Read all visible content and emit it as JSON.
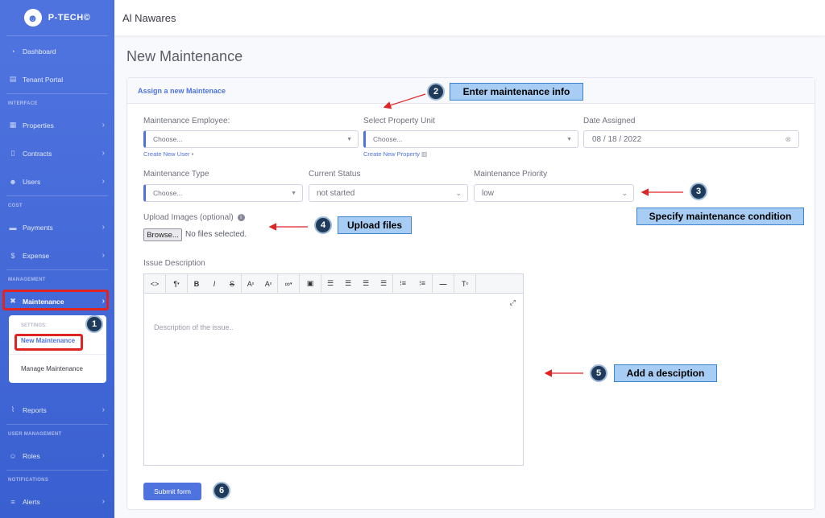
{
  "sidebar": {
    "brand": "P-TECH©",
    "items": [
      {
        "label": "Dashboard",
        "icon": "dashboard-icon"
      },
      {
        "label": "Tenant Portal",
        "icon": "portal-icon"
      }
    ],
    "headings": {
      "interface": "INTERFACE",
      "cost": "COST",
      "management": "MANAGEMENT",
      "user_management": "USER MANAGEMENT",
      "notifications": "NOTIFICATIONS"
    },
    "interface_items": [
      "Properties",
      "Contracts",
      "Users"
    ],
    "cost_items": [
      "Payments",
      "Expense"
    ],
    "maintenance": "Maintenance",
    "submenu": {
      "heading": "SETTINGS:",
      "new": "New Maintenance",
      "manage": "Manage Maintenance"
    },
    "reports": "Reports",
    "roles": "Roles",
    "alerts": "Alerts"
  },
  "topbar": {
    "title": "Al Nawares"
  },
  "page_title": "New Maintenance",
  "card": {
    "header": "Assign a new Maintenace"
  },
  "form": {
    "employee_label": "Maintenance Employee:",
    "employee_value": "Choose...",
    "create_user": "Create New User",
    "property_label": "Select Property Unit",
    "property_value": "Choose...",
    "create_property": "Create New Property",
    "date_label": "Date Assigned",
    "date_value": "08 / 18 / 2022",
    "type_label": "Maintenance Type",
    "type_value": "Choose...",
    "status_label": "Current Status",
    "status_value": "not started",
    "priority_label": "Maintenance Priority",
    "priority_value": "low",
    "upload_label": "Upload Images (optional)",
    "browse": "Browse...",
    "no_files": "No files selected.",
    "issue_label": "Issue Description",
    "issue_placeholder": "Description of the issue..",
    "submit": "Submit form"
  },
  "editor_toolbar": [
    "<>",
    "¶",
    "B",
    "I",
    "S",
    "A",
    "A",
    "link",
    "image",
    "align-left",
    "align-center",
    "align-right",
    "justify",
    "ul",
    "ol",
    "hr",
    "clear-format"
  ],
  "annotations": {
    "n1": "1",
    "n2": "2",
    "n3": "3",
    "n4": "4",
    "n5": "5",
    "n6": "6",
    "label2": "Enter maintenance info",
    "label3": "Specify maintenance condition",
    "label4": "Upload files",
    "label5": "Add a desciption"
  },
  "colors": {
    "primary": "#4e73df",
    "highlight": "#e02424",
    "annotation_bg": "#a8cdf4",
    "annotation_circle": "#1f3b5c"
  }
}
